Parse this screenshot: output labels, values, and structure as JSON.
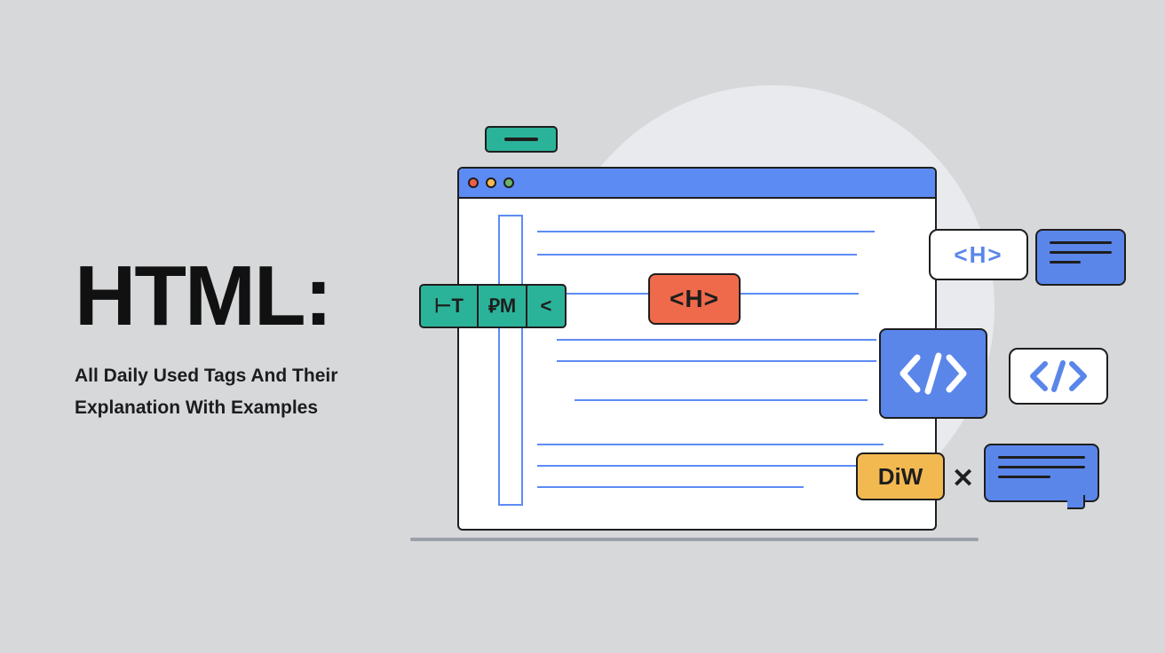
{
  "headline": "HTML:",
  "subtitle_line1": "All Daily Used Tags And Their",
  "subtitle_line2": "Explanation With Examples",
  "chips": {
    "html_seg_a": "⊢T",
    "html_seg_b": "⃉M",
    "html_seg_c": "<",
    "h_red": "<H>",
    "h_white": "<H>",
    "div_yellow": "DiW",
    "x": "✕"
  }
}
